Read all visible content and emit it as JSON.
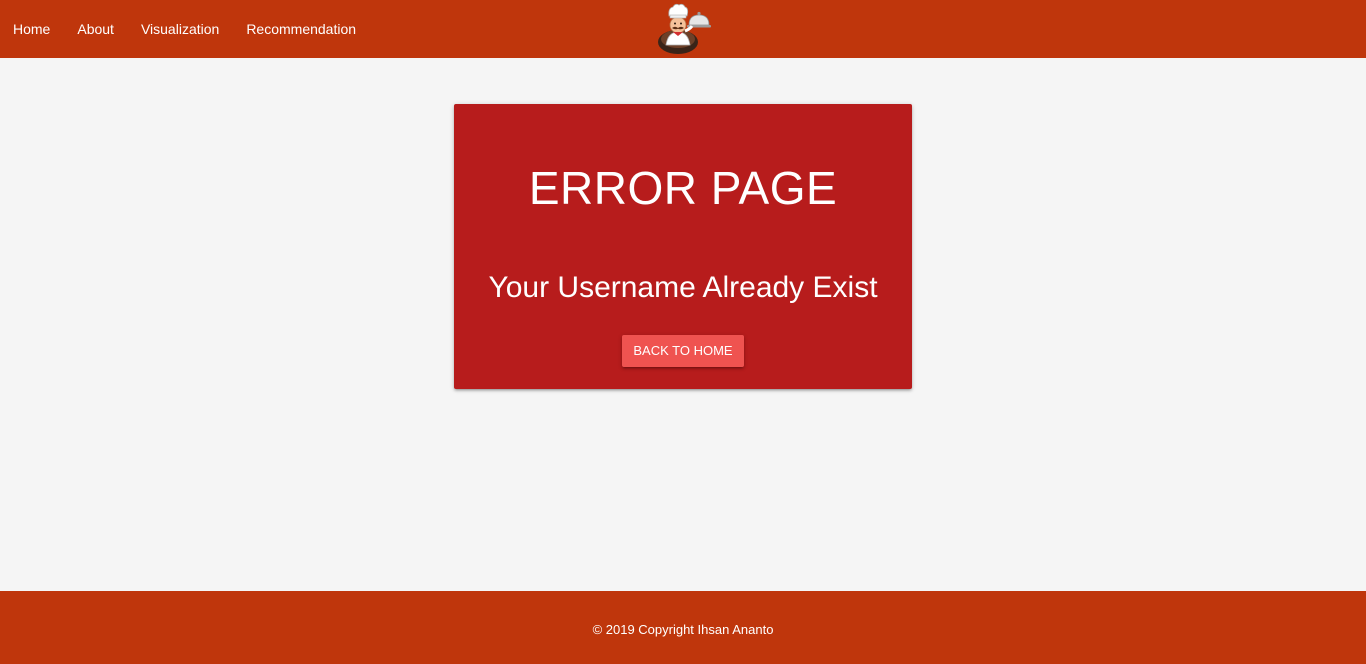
{
  "navbar": {
    "background_color": "#bf360c",
    "links": [
      {
        "label": "Home"
      },
      {
        "label": "About"
      },
      {
        "label": "Visualization"
      },
      {
        "label": "Recommendation"
      }
    ],
    "logo_icon": "chef-logo-icon"
  },
  "error_card": {
    "background_color": "#b71c1c",
    "title": "ERROR PAGE",
    "message": "Your Username Already Exist",
    "button_label": "BACK TO HOME",
    "button_color": "#ef5350"
  },
  "footer": {
    "background_color": "#bf360c",
    "copyright": "© 2019 Copyright Ihsan Ananto"
  }
}
